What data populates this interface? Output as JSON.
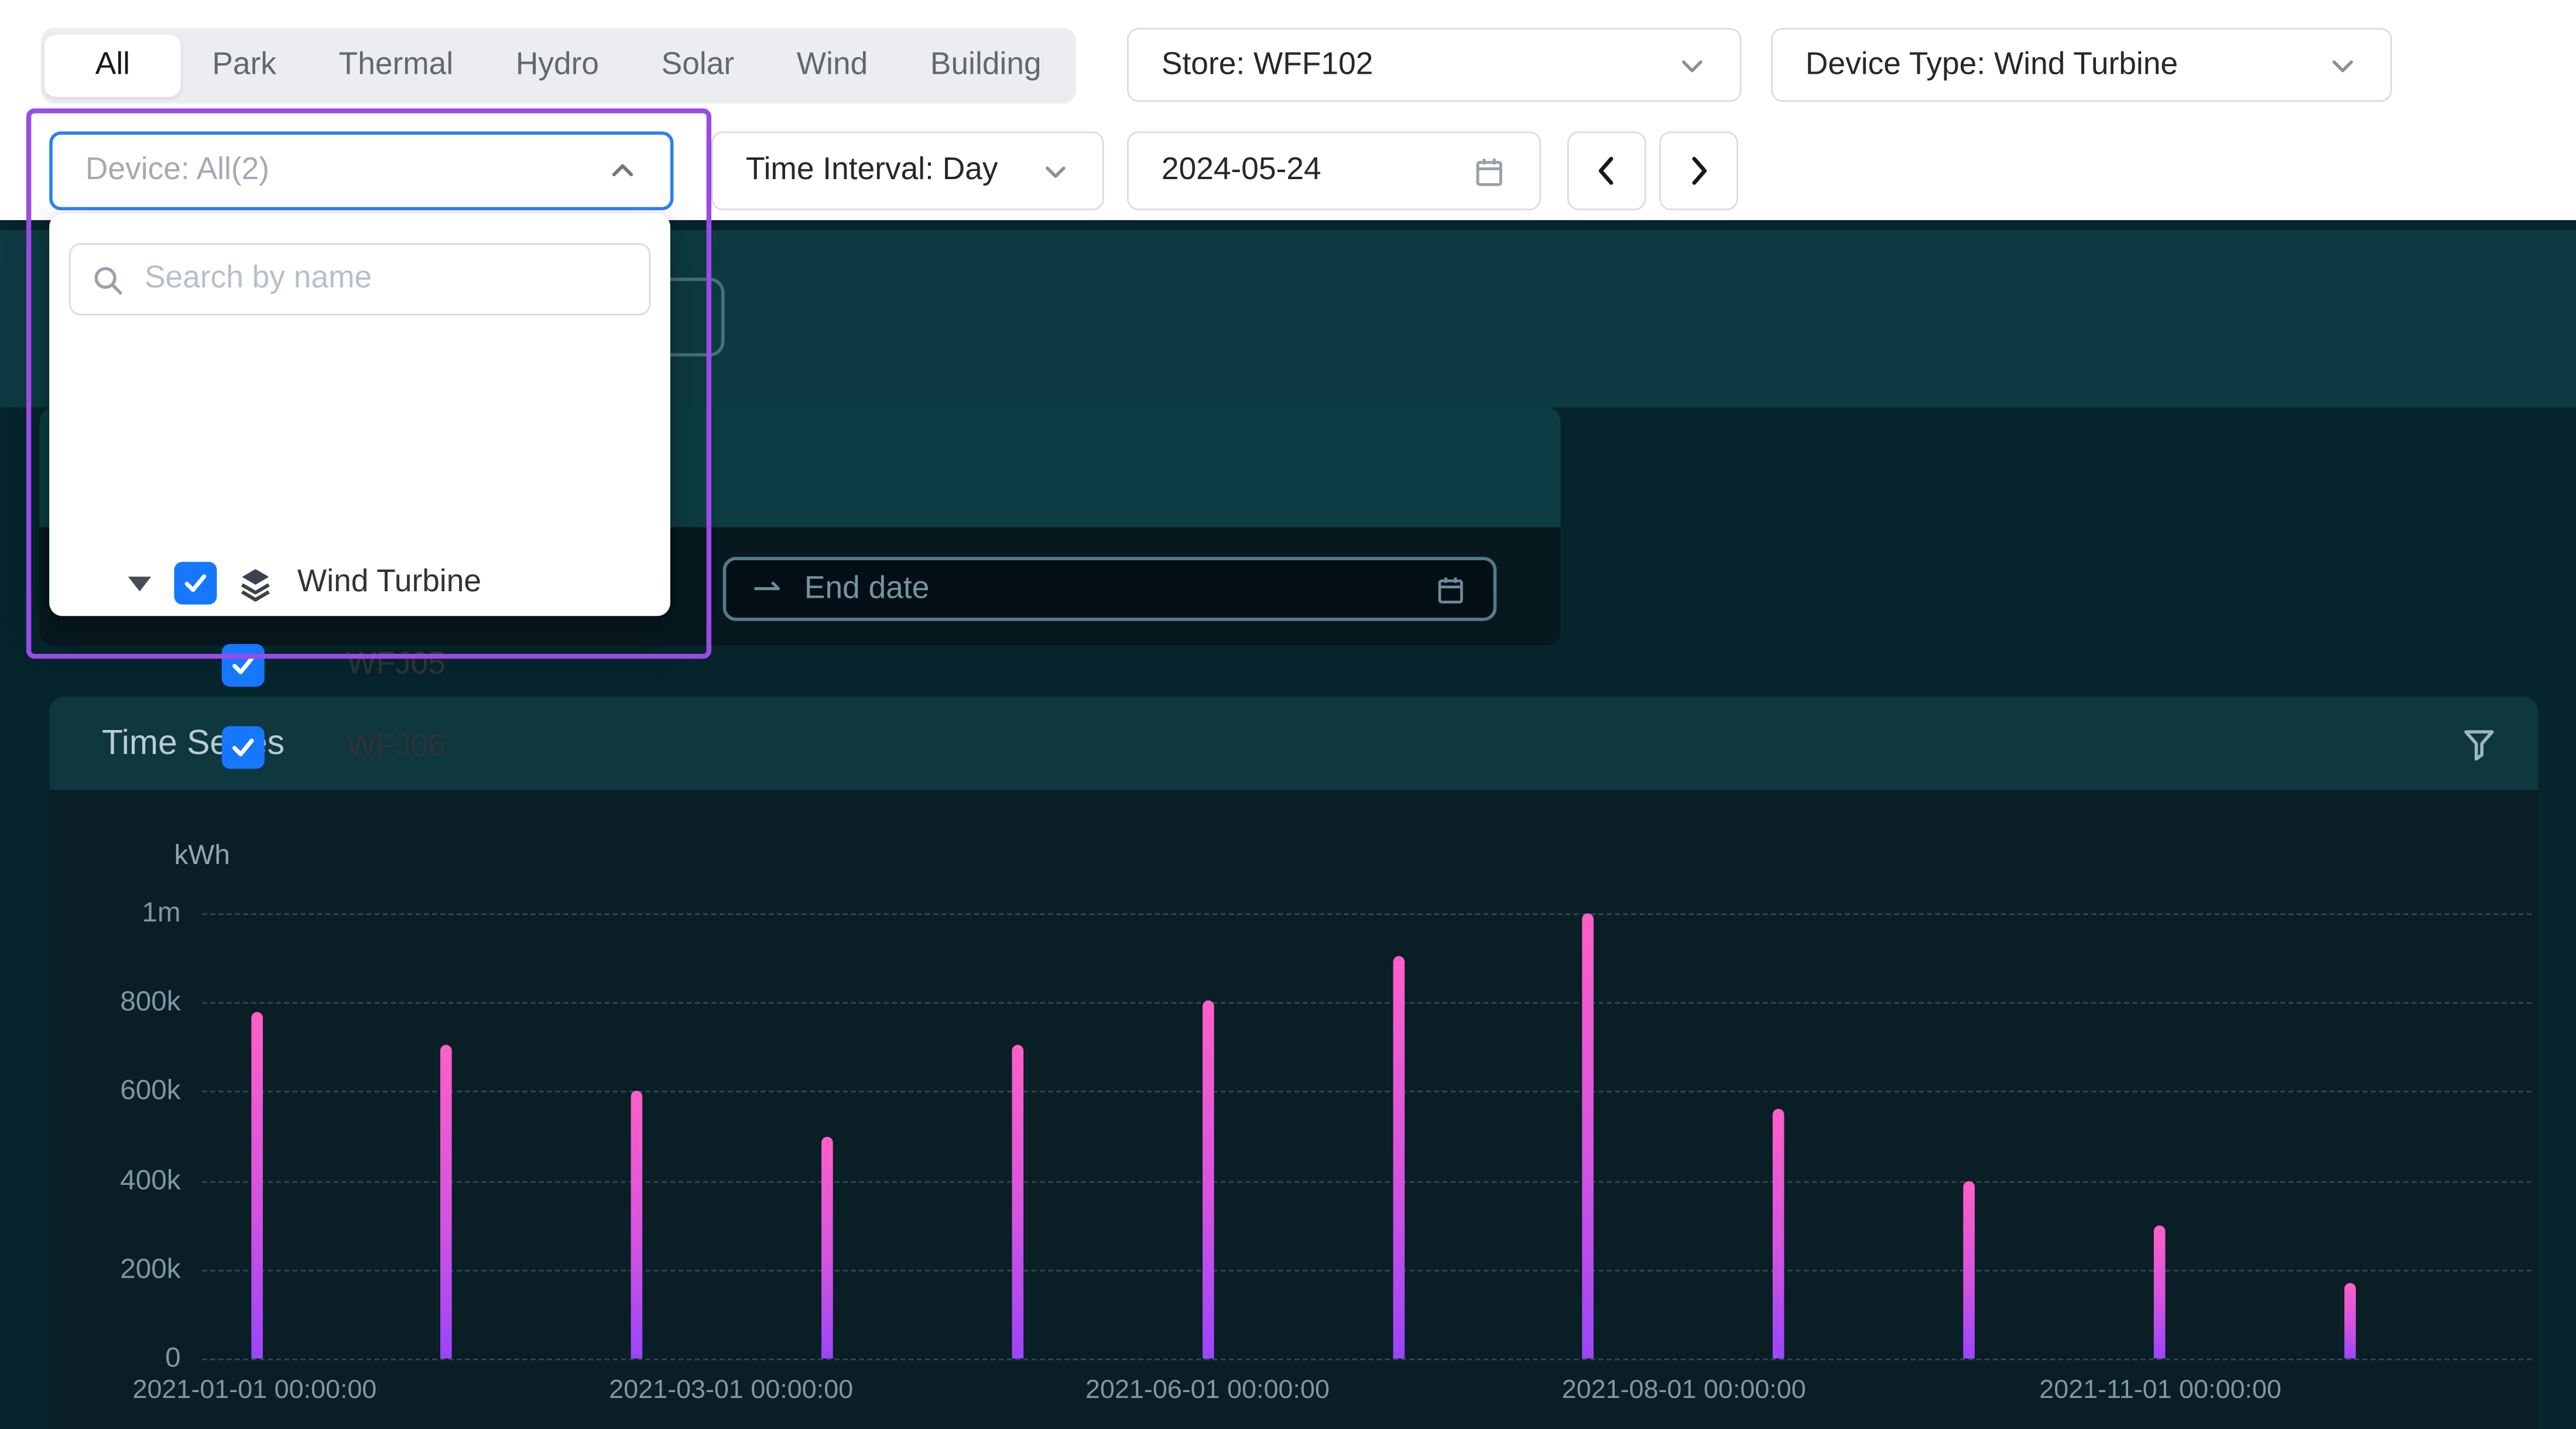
{
  "header": {
    "tabs": {
      "items": [
        "All",
        "Park",
        "Thermal",
        "Hydro",
        "Solar",
        "Wind",
        "Building"
      ],
      "active": "All"
    },
    "store_select": {
      "label": "Store: WFF102"
    },
    "device_type_select": {
      "label": "Device Type: Wind Turbine"
    },
    "device_select": {
      "label": "Device: All(2)"
    },
    "time_interval_select": {
      "label": "Time Interval: Day"
    },
    "date_input": {
      "value": "2024-05-24"
    }
  },
  "device_popup": {
    "search": {
      "placeholder": "Search by name"
    },
    "tree": [
      {
        "label": "Wind Turbine",
        "checked": true,
        "expanded": true,
        "group": true
      },
      {
        "label": "WFJ05",
        "checked": true,
        "group": false
      },
      {
        "label": "WFJ06",
        "checked": true,
        "group": false
      }
    ]
  },
  "content": {
    "end_date_placeholder": "End date",
    "panel_title": "Time Series"
  },
  "chart_data": {
    "type": "bar",
    "title": "Time Series",
    "ylabel": "kWh",
    "ylim": [
      0,
      1000000
    ],
    "grid": "dashed-horizontal",
    "x": [
      "2021-01-01",
      "2021-02-01",
      "2021-03-01",
      "2021-04-01",
      "2021-05-01",
      "2021-06-01",
      "2021-07-01",
      "2021-08-01",
      "2021-09-01",
      "2021-10-01",
      "2021-11-01",
      "2021-12-01"
    ],
    "values": [
      780000,
      705000,
      600000,
      500000,
      705000,
      805000,
      905000,
      1000000,
      560000,
      400000,
      300000,
      170000
    ],
    "y_ticks": [
      {
        "label": "1m",
        "value": 1000000
      },
      {
        "label": "800k",
        "value": 800000
      },
      {
        "label": "600k",
        "value": 600000
      },
      {
        "label": "400k",
        "value": 400000
      },
      {
        "label": "200k",
        "value": 200000
      },
      {
        "label": "0",
        "value": 0
      }
    ],
    "x_tick_labels": [
      "2021-01-01 00:00:00",
      "2021-03-01 00:00:00",
      "2021-06-01 00:00:00",
      "2021-08-01 00:00:00",
      "2021-11-01 00:00:00"
    ],
    "bar_gradient_top": "#ff5fc8",
    "bar_gradient_bottom": "#9b45fa"
  },
  "colors": {
    "accent_blue": "#2e7ef0",
    "checkbox_blue": "#1677ff",
    "highlight_purple": "#9b4be4",
    "panel_header": "#0e373f",
    "chart_bg": "#0a1e26"
  }
}
